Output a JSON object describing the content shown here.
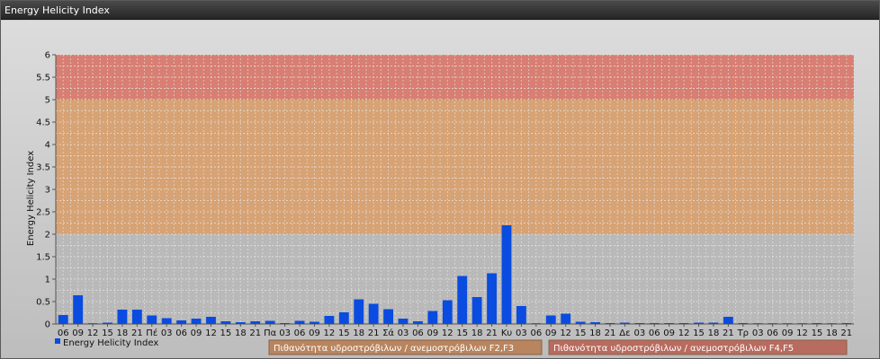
{
  "window": {
    "title": "Energy Helicity Index"
  },
  "chart_data": {
    "type": "bar",
    "title": "",
    "ylabel": "Energy Helicity Index",
    "xlabel": "",
    "ylim": [
      0,
      6
    ],
    "yticks": [
      "0",
      "0.5",
      "1",
      "1.5",
      "2",
      "2.5",
      "3",
      "3.5",
      "4",
      "4.5",
      "5",
      "5.5",
      "6"
    ],
    "grid": true,
    "bar_color": "#0a4be0",
    "categories": [
      "06",
      "09",
      "12",
      "15",
      "18",
      "21",
      "Πέ",
      "03",
      "06",
      "09",
      "12",
      "15",
      "18",
      "21",
      "Πα",
      "03",
      "06",
      "09",
      "12",
      "15",
      "18",
      "21",
      "Σά",
      "03",
      "06",
      "09",
      "12",
      "15",
      "18",
      "21",
      "Κυ",
      "03",
      "06",
      "09",
      "12",
      "15",
      "18",
      "21",
      "Δε",
      "03",
      "06",
      "09",
      "12",
      "15",
      "18",
      "21",
      "Τρ",
      "03",
      "06",
      "09",
      "12",
      "15",
      "18",
      "21"
    ],
    "series": [
      {
        "name": "Energy Helicity Index",
        "values": [
          0.2,
          0.64,
          0.01,
          0.03,
          0.32,
          0.32,
          0.19,
          0.13,
          0.08,
          0.12,
          0.16,
          0.06,
          0.04,
          0.06,
          0.07,
          0.02,
          0.07,
          0.05,
          0.18,
          0.26,
          0.55,
          0.45,
          0.33,
          0.12,
          0.06,
          0.29,
          0.53,
          1.07,
          0.6,
          1.13,
          2.2,
          0.4,
          0.01,
          0.19,
          0.23,
          0.05,
          0.04,
          0.02,
          0.03,
          0.02,
          0.02,
          0.02,
          0.02,
          0.03,
          0.03,
          0.16,
          0.02,
          0.01,
          0.01,
          0.01,
          0.01,
          0.02,
          0.01,
          0.02
        ]
      }
    ],
    "bands": [
      {
        "from": 2,
        "to": 5,
        "color": "#d8a070",
        "label": "Πιθανότητα υδροστρόβιλων / ανεμοστρόβιλων F2,F3"
      },
      {
        "from": 5,
        "to": 6,
        "color": "#d97a6e",
        "label": "Πιθανότητα υδροστρόβιλων / ανεμοστρόβιλων F4,F5"
      }
    ],
    "legend": {
      "placement": "bottom-left"
    }
  }
}
